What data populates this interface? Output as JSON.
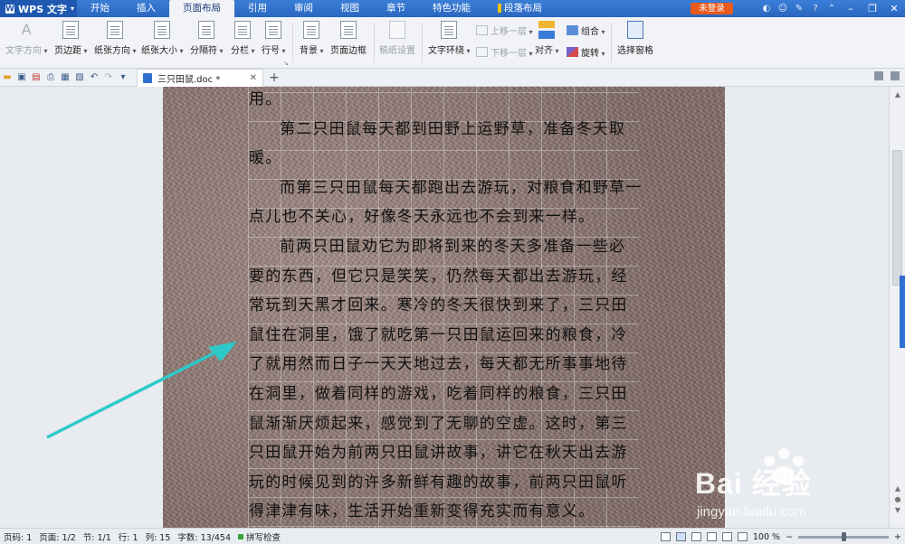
{
  "menubar": {
    "app_name": "WPS 文字",
    "tabs": [
      "开始",
      "插入",
      "页面布局",
      "引用",
      "审阅",
      "视图",
      "章节",
      "特色功能",
      "段落布局"
    ],
    "active_tab": "页面布局",
    "login_label": "未登录",
    "help_label": "?"
  },
  "ribbon": {
    "text_direction": "文字方向",
    "margins": "页边距",
    "orientation": "纸张方向",
    "paper_size": "纸张大小",
    "separator": "分隔符",
    "columns": "分栏",
    "line_numbers": "行号",
    "background": "背景",
    "page_border": "页面边框",
    "manuscript": "稿纸设置",
    "text_wrap": "文字环绕",
    "bring_forward": "上移一层",
    "send_backward": "下移一层",
    "align": "对齐",
    "group": "组合",
    "rotate": "旋转",
    "selection_pane": "选择窗格"
  },
  "doc_tab": {
    "filename": "三只田鼠.doc *",
    "new_tab": "+"
  },
  "document": {
    "lines": [
      {
        "text": "用。",
        "indent": false
      },
      {
        "text": "第二只田鼠每天都到田野上运野草，准备冬天取",
        "indent": true
      },
      {
        "text": "暖。",
        "indent": false
      },
      {
        "text": "而第三只田鼠每天都跑出去游玩，对粮食和野草一",
        "indent": true
      },
      {
        "text": "点儿也不关心，好像冬天永远也不会到来一样。",
        "indent": false
      },
      {
        "text": "前两只田鼠劝它为即将到来的冬天多准备一些必",
        "indent": true
      },
      {
        "text": "要的东西，但它只是笑笑，仍然每天都出去游玩，经",
        "indent": false
      },
      {
        "text": "常玩到天黑才回来。寒冷的冬天很快到来了，三只田",
        "indent": false
      },
      {
        "text": "鼠住在洞里，饿了就吃第一只田鼠运回来的粮食，冷",
        "indent": false
      },
      {
        "text": "了就用然而日子一天天地过去，每天都无所事事地待",
        "indent": false
      },
      {
        "text": "在洞里，做着同样的游戏，吃着同样的粮食，三只田",
        "indent": false
      },
      {
        "text": "鼠渐渐厌烦起来，感觉到了无聊的空虚。这时，第三",
        "indent": false
      },
      {
        "text": "只田鼠开始为前两只田鼠讲故事，讲它在秋天出去游",
        "indent": false
      },
      {
        "text": "玩的时候见到的许多新鲜有趣的故事，前两只田鼠听",
        "indent": false
      },
      {
        "text": "得津津有味，生活开始重新变得充实而有意义。",
        "indent": false
      }
    ]
  },
  "statusbar": {
    "page": "页码: 1",
    "pages": "页面: 1/2",
    "section": "节: 1/1",
    "row": "行: 1",
    "col": "列: 15",
    "words": "字数: 13/454",
    "spell": "拼写检查",
    "zoom": "100 %",
    "zoom_fraction": 0.5
  },
  "watermark": {
    "main": "Bai 经验",
    "sub": "jingyan.baidu.com"
  },
  "colors": {
    "title_bar": "#2a67c0",
    "login": "#e85a1e",
    "arrow": "#2ec9c9",
    "page_texture": "#8b7670"
  }
}
